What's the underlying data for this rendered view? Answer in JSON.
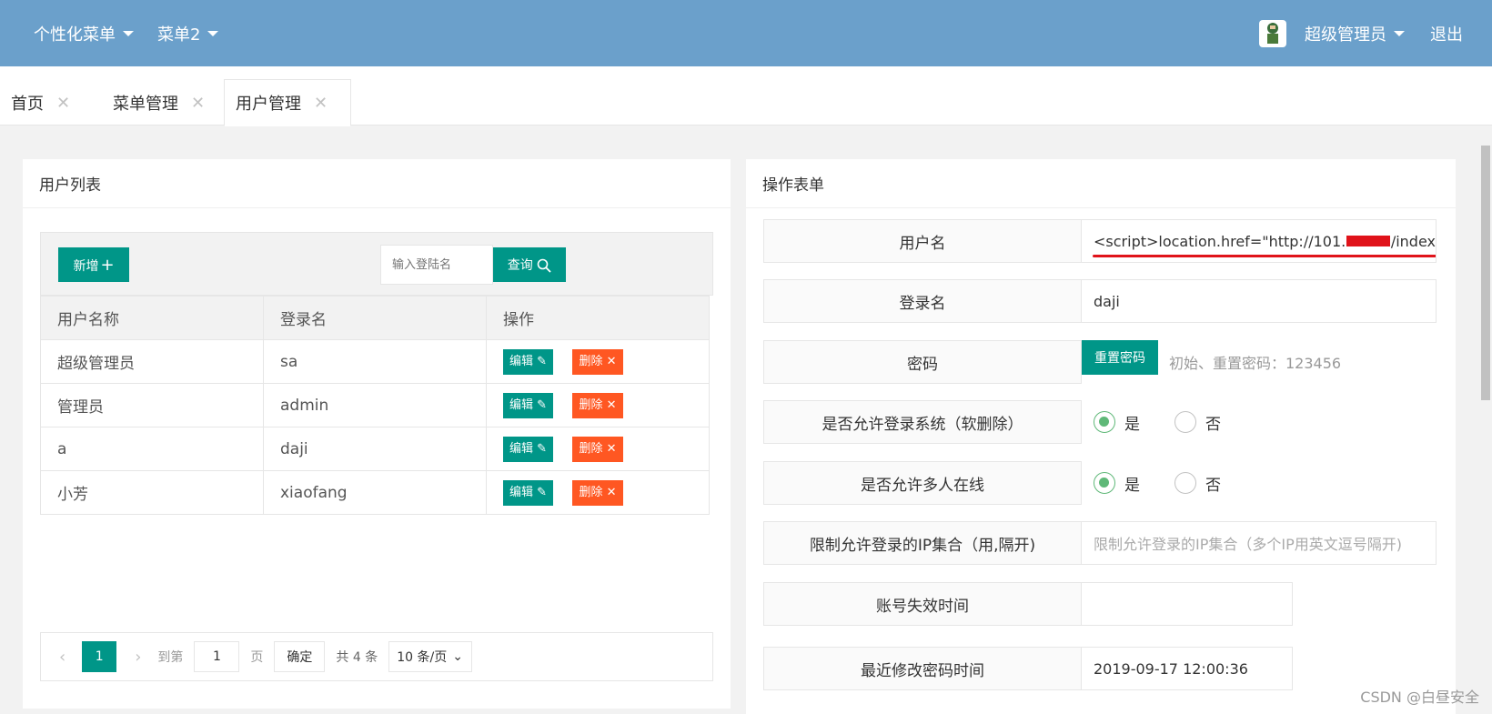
{
  "header": {
    "menu1": "个性化菜单",
    "menu2": "菜单2",
    "user": "超级管理员",
    "logout": "退出"
  },
  "tabs": [
    {
      "label": "首页"
    },
    {
      "label": "菜单管理"
    },
    {
      "label": "用户管理",
      "active": true
    }
  ],
  "user_list": {
    "title": "用户列表",
    "add_label": "新增",
    "search_placeholder": "输入登陆名",
    "query_label": "查询",
    "columns": [
      "用户名称",
      "登录名",
      "操作"
    ],
    "edit_label": "编辑",
    "delete_label": "删除",
    "rows": [
      {
        "name": "超级管理员",
        "login": "sa"
      },
      {
        "name": "管理员",
        "login": "admin"
      },
      {
        "name": "a",
        "login": "daji"
      },
      {
        "name": "小芳",
        "login": "xiaofang"
      }
    ],
    "pager": {
      "current": "1",
      "goto_label": "到第",
      "page_value": "1",
      "page_unit": "页",
      "confirm": "确定",
      "total": "共 4 条",
      "page_size": "10 条/页"
    }
  },
  "form": {
    "title": "操作表单",
    "username_label": "用户名",
    "username_value": "<script>location.href=\"http://101.",
    "username_value_tail": "/index",
    "login_label": "登录名",
    "login_value": "daji",
    "password_label": "密码",
    "reset_label": "重置密码",
    "password_hint": "初始、重置密码：123456",
    "allow_login_label": "是否允许登录系统（软删除）",
    "yes": "是",
    "no": "否",
    "multi_online_label": "是否允许多人在线",
    "ip_label": "限制允许登录的IP集合（用,隔开)",
    "ip_placeholder": "限制允许登录的IP集合（多个IP用英文逗号隔开)",
    "expire_label": "账号失效时间",
    "expire_value": "",
    "pwd_time_label": "最近修改密码时间",
    "pwd_time_value": "2019-09-17 12:00:36"
  },
  "watermark": "CSDN @白昼安全"
}
